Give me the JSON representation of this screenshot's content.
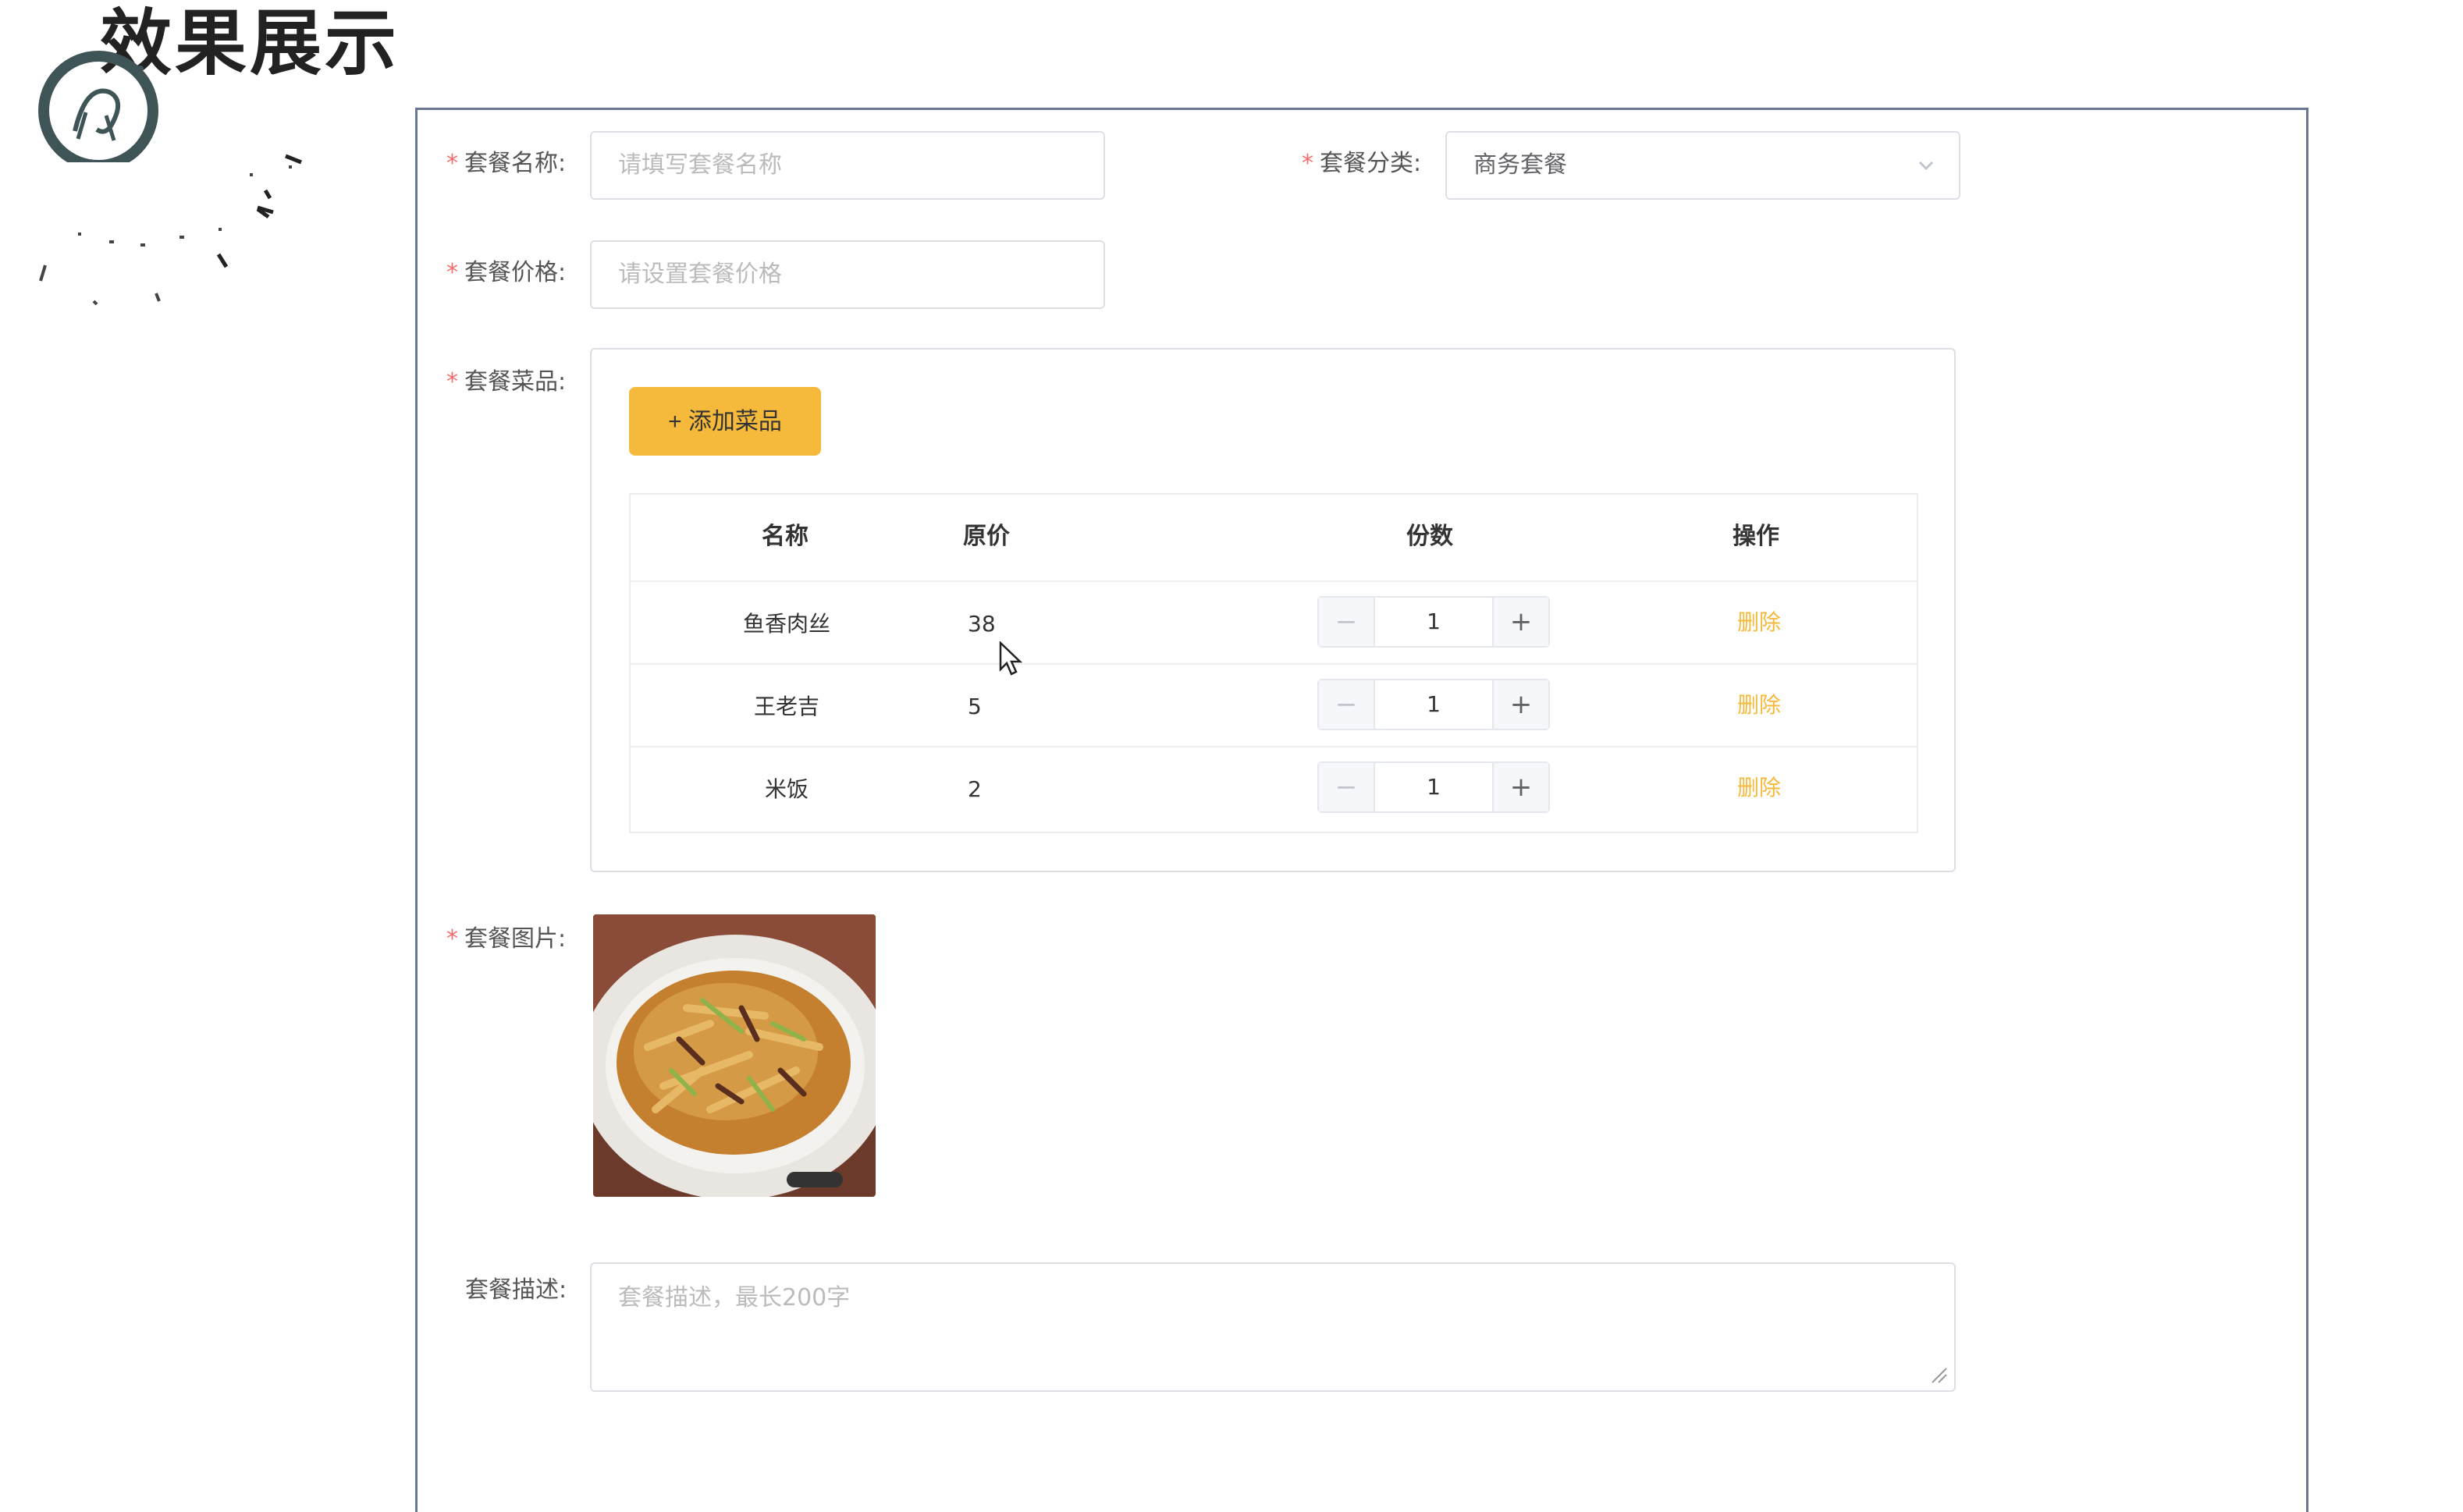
{
  "slide": {
    "title": "效果展示"
  },
  "form": {
    "name": {
      "label": "套餐名称:",
      "placeholder": "请填写套餐名称"
    },
    "category": {
      "label": "套餐分类:",
      "value": "商务套餐"
    },
    "price": {
      "label": "套餐价格:",
      "placeholder": "请设置套餐价格"
    },
    "dishes": {
      "label": "套餐菜品:",
      "add_button": "+ 添加菜品",
      "columns": [
        "名称",
        "原价",
        "份数",
        "操作"
      ],
      "rows": [
        {
          "name": "鱼香肉丝",
          "price": "38",
          "qty": "1",
          "action": "删除"
        },
        {
          "name": "王老吉",
          "price": "5",
          "qty": "1",
          "action": "删除"
        },
        {
          "name": "米饭",
          "price": "2",
          "qty": "1",
          "action": "删除"
        }
      ],
      "minus": "−",
      "plus": "+"
    },
    "image": {
      "label": "套餐图片:"
    },
    "description": {
      "label": "套餐描述:",
      "placeholder": "套餐描述，最长200字"
    },
    "required_mark": "*"
  },
  "colors": {
    "accent": "#f5b93b",
    "required": "#f56c6c",
    "frame": "#6a7794"
  },
  "icons": {
    "logo": "dragon-logo-icon",
    "chevron": "chevron-down-icon",
    "cursor": "mouse-cursor-icon",
    "resize": "resize-grip-icon"
  }
}
